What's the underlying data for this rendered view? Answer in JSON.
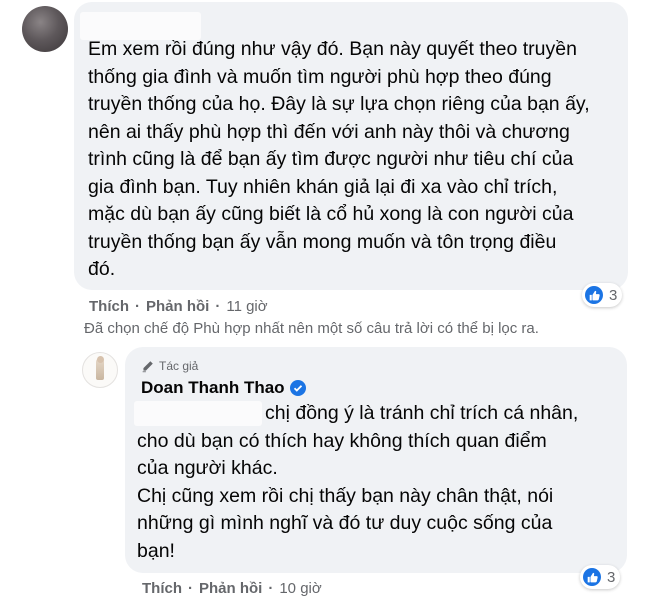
{
  "comment1": {
    "text": "Em xem rồi đúng như vậy đó. Bạn này quyết theo truyền\nthống gia đình và muốn tìm người phù hợp theo đúng\ntruyền thống của họ. Đây là sự lựa chọn riêng của bạn ấy,\nnên ai thấy phù hợp thì đến với anh này thôi và chương\ntrình cũng là để bạn ấy tìm được người như tiêu chí của\ngia đình bạn. Tuy nhiên khán giả lại đi xa vào chỉ trích,\nmặc dù bạn ấy cũng biết là cổ hủ xong là con người của\ntruyền thống bạn ấy vẫn mong muốn và tôn trọng điều\nđó.",
    "like_label": "Thích",
    "reply_label": "Phản hồi",
    "time": "11 giờ",
    "reaction_count": "3"
  },
  "filter_note": "Đã chọn chế độ Phù hợp nhất nên một số câu trả lời có thể bị lọc ra.",
  "reply": {
    "badge": "Tác giả",
    "author": "Doan Thanh Thao",
    "text": "chị đồng ý là tránh chỉ trích cá nhân,\ncho dù bạn có thích hay không thích quan điểm\ncủa người khác.\nChị cũng xem rồi chị thấy bạn này chân thật, nói\nnhững gì mình nghĩ và đó tư duy cuộc sống của\nbạn!",
    "like_label": "Thích",
    "reply_label": "Phản hồi",
    "time": "10 giờ",
    "reaction_count": "3"
  },
  "colors": {
    "bubble": "#f0f2f5",
    "meta": "#65676b",
    "like_blue": "#1b74e4"
  }
}
